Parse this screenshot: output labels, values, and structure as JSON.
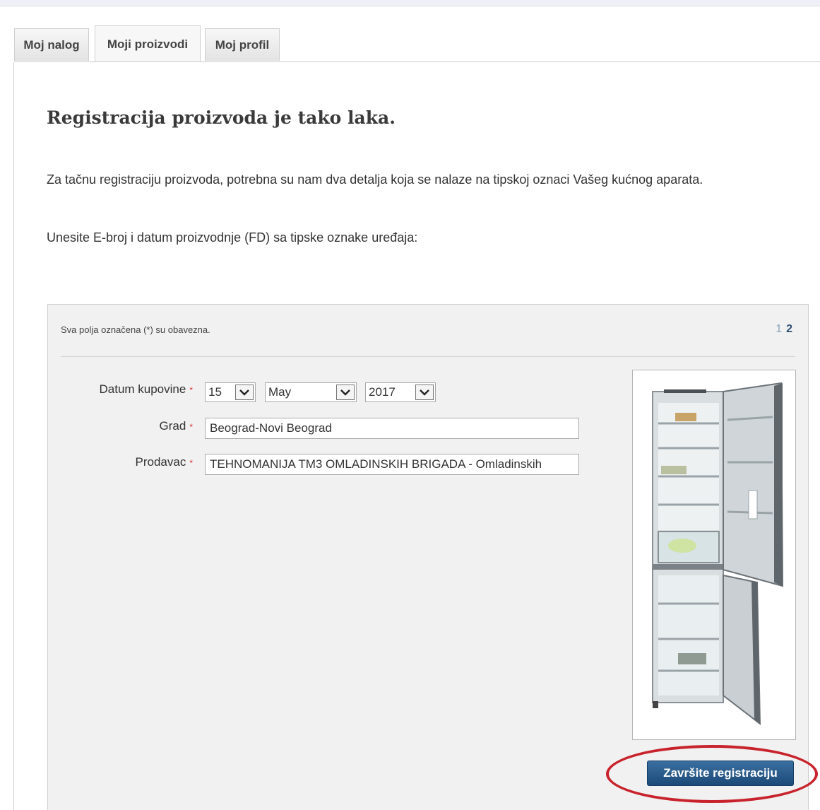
{
  "tabs": [
    {
      "label": "Moj nalog",
      "active": false
    },
    {
      "label": "Moji proizvodi",
      "active": true
    },
    {
      "label": "Moj profil",
      "active": false
    }
  ],
  "heading": "Registracija proizvoda je tako laka.",
  "intro": "Za tačnu registraciju proizvoda, potrebna su nam dva detalja koja se nalaze na tipskoj oznaci Vašeg kućnog aparata.",
  "instruction": "Unesite E-broj i datum proizvodnje (FD) sa tipske oznake uređaja:",
  "form": {
    "required_note": "Sva polja označena (*) su obavezna.",
    "pager": {
      "page1": "1",
      "page2": "2",
      "current": 2
    },
    "required_marker": "*",
    "purchase_date": {
      "label": "Datum kupovine",
      "day": "15",
      "month": "May",
      "year": "2017"
    },
    "city": {
      "label": "Grad",
      "value": "Beograd-Novi Beograd"
    },
    "seller": {
      "label": "Prodavac",
      "value": "TEHNOMANIJA TM3 OMLADINSKIH BRIGADA - Omladinskih"
    },
    "product_image": "refrigerator-image",
    "submit_label": "Završite registraciju"
  },
  "colors": {
    "button": "#1c4a78",
    "highlight": "#c8232c",
    "required": "#dd3333"
  }
}
